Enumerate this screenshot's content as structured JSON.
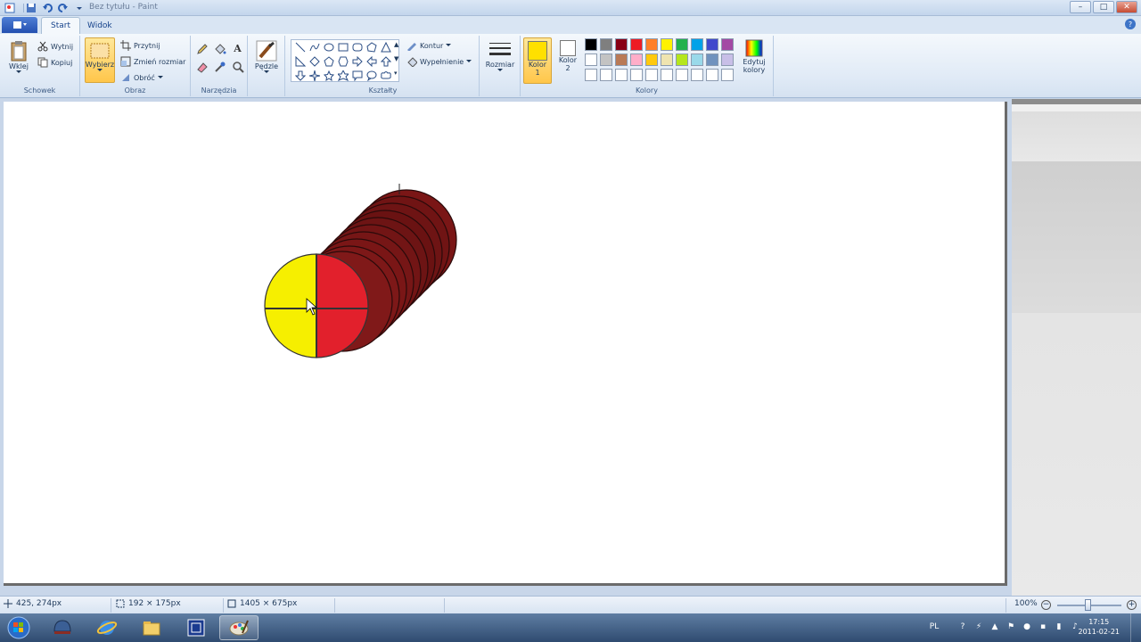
{
  "titlebar": {
    "title": "Bez tytułu - Paint",
    "controls": {
      "minimize": "–",
      "maximize": "□",
      "close": "✕"
    }
  },
  "tabs": [
    {
      "label": "Start",
      "active": true
    },
    {
      "label": "Widok",
      "active": false
    }
  ],
  "ribbon": {
    "clipboard": {
      "label": "Schowek",
      "paste": "Wklej",
      "cut": "Wytnij",
      "copy": "Kopiuj"
    },
    "image": {
      "label": "Obraz",
      "select": "Wybierz",
      "crop": "Przytnij",
      "resize": "Zmień rozmiar",
      "rotate": "Obróć"
    },
    "tools": {
      "label": "Narzędzia",
      "brushes": "Pędzle"
    },
    "shapes": {
      "label": "Kształty",
      "outline": "Kontur",
      "fill": "Wypełnienie"
    },
    "size": {
      "label": "Rozmiar"
    },
    "colors": {
      "label": "Kolory",
      "color1": "Kolor\n1",
      "color1_line1": "Kolor",
      "color1_line2": "1",
      "color2_line1": "Kolor",
      "color2_line2": "2",
      "edit_line1": "Edytuj",
      "edit_line2": "kolory",
      "color1_value": "#ffe000",
      "color2_value": "#ffffff",
      "palette_row1": [
        "#000000",
        "#7f7f7f",
        "#880015",
        "#ed1c24",
        "#ff7f27",
        "#fff200",
        "#22b14c",
        "#00a2e8",
        "#3f48cc",
        "#a349a4"
      ],
      "palette_row2": [
        "#ffffff",
        "#c3c3c3",
        "#b97a57",
        "#ffaec9",
        "#ffc90e",
        "#efe4b0",
        "#b5e61d",
        "#99d9ea",
        "#7092be",
        "#c8bfe7"
      ],
      "palette_row3": [
        "#ffffff",
        "#ffffff",
        "#ffffff",
        "#ffffff",
        "#ffffff",
        "#ffffff",
        "#ffffff",
        "#ffffff",
        "#ffffff",
        "#ffffff"
      ]
    }
  },
  "status": {
    "cursor_pos": "425, 274px",
    "selection_size": "192 × 175px",
    "image_size": "1405 × 675px",
    "zoom": "100%"
  },
  "taskbar": {
    "time": "17:15",
    "date": "2011-02-21",
    "lang": "PL"
  }
}
